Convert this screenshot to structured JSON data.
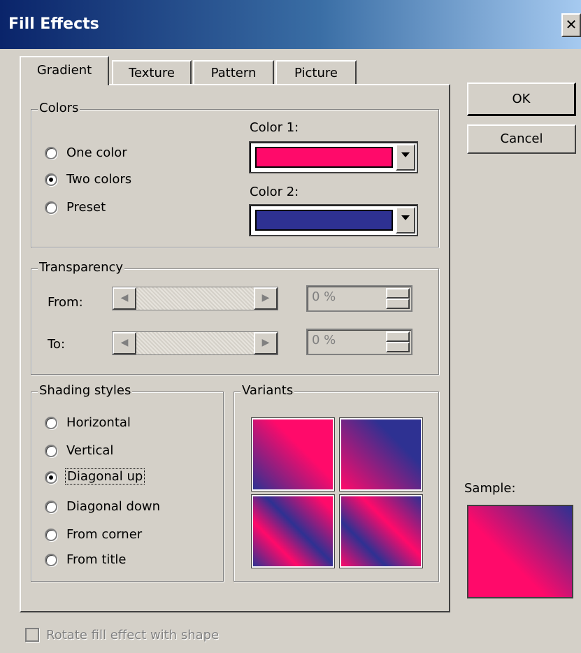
{
  "window": {
    "title": "Fill Effects",
    "close_glyph": "✕"
  },
  "tabs": [
    {
      "label": "Gradient",
      "active": true
    },
    {
      "label": "Texture",
      "active": false
    },
    {
      "label": "Pattern",
      "active": false
    },
    {
      "label": "Picture",
      "active": false
    }
  ],
  "buttons": {
    "ok": "OK",
    "cancel": "Cancel"
  },
  "colors": {
    "group_label": "Colors",
    "radios": [
      {
        "label": "One color",
        "selected": false
      },
      {
        "label": "Two colors",
        "selected": true
      },
      {
        "label": "Preset",
        "selected": false
      }
    ],
    "color1_label": "Color 1:",
    "color1_value": "#ff0a6a",
    "color2_label": "Color 2:",
    "color2_value": "#2e3192"
  },
  "transparency": {
    "group_label": "Transparency",
    "from_label": "From:",
    "from_value": "0 %",
    "to_label": "To:",
    "to_value": "0 %"
  },
  "shading": {
    "group_label": "Shading styles",
    "options": [
      {
        "label": "Horizontal",
        "selected": false
      },
      {
        "label": "Vertical",
        "selected": false
      },
      {
        "label": "Diagonal up",
        "selected": true
      },
      {
        "label": "Diagonal down",
        "selected": false
      },
      {
        "label": "From corner",
        "selected": false
      },
      {
        "label": "From title",
        "selected": false
      }
    ]
  },
  "variants": {
    "group_label": "Variants"
  },
  "sample": {
    "label": "Sample:"
  },
  "rotate_checkbox": {
    "label": "Rotate fill effect with shape",
    "checked": false,
    "enabled": false
  }
}
